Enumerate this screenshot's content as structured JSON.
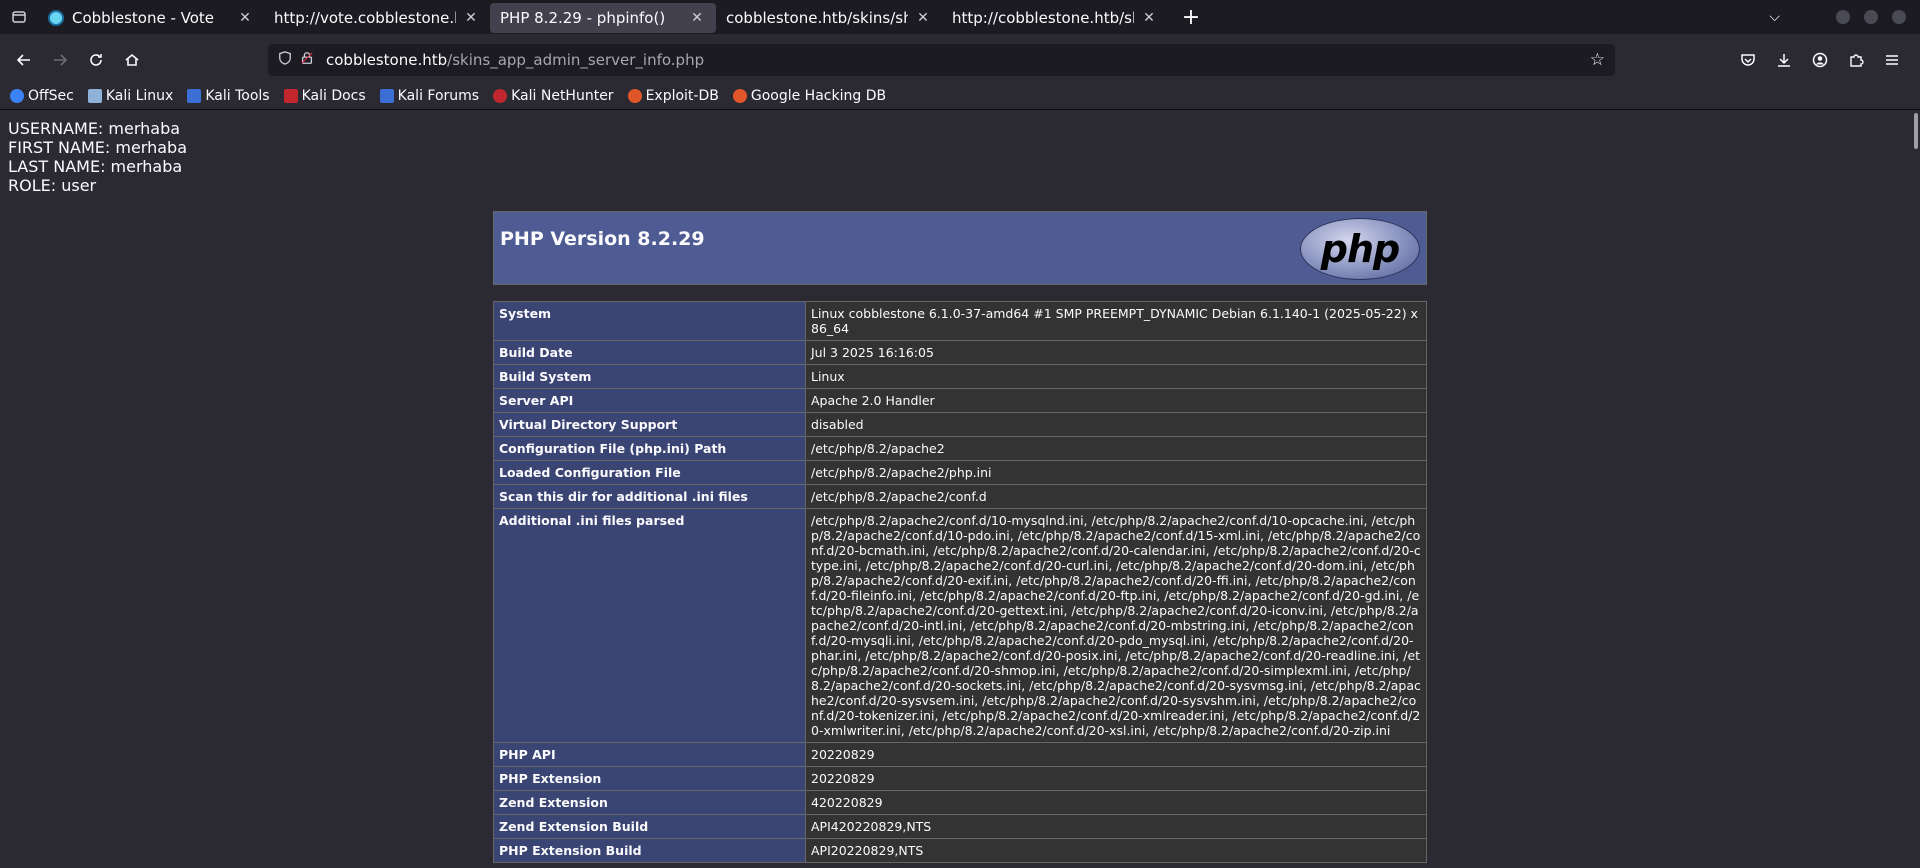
{
  "tabs": [
    {
      "title": "Cobblestone - Vote",
      "dim": "",
      "active": false
    },
    {
      "title": "http://vote.cobblestone.htb/",
      "dim": "l",
      "active": false
    },
    {
      "title": "PHP 8.2.29 - phpinfo()",
      "dim": "",
      "active": true
    },
    {
      "title": "cobblestone.htb/skins/shell.",
      "dim": "p",
      "active": false
    },
    {
      "title": "http://cobblestone.htb/skins/",
      "dim": "",
      "active": false
    }
  ],
  "url": {
    "host": "cobblestone.htb",
    "path": "/skins_app_admin_server_info.php"
  },
  "bookmarks": [
    {
      "label": "OffSec",
      "color": "#3b82f6"
    },
    {
      "label": "Kali Linux",
      "color": "#8fb2d8"
    },
    {
      "label": "Kali Tools",
      "color": "#3b6fd6"
    },
    {
      "label": "Kali Docs",
      "color": "#c2272d"
    },
    {
      "label": "Kali Forums",
      "color": "#3b6fd6"
    },
    {
      "label": "Kali NetHunter",
      "color": "#c2272d"
    },
    {
      "label": "Exploit-DB",
      "color": "#e0562a"
    },
    {
      "label": "Google Hacking DB",
      "color": "#e0562a"
    }
  ],
  "user": {
    "username": "USERNAME: merhaba",
    "first_name": "FIRST NAME: merhaba",
    "last_name": "LAST NAME: merhaba",
    "role": "ROLE: user"
  },
  "php": {
    "version_title": "PHP Version 8.2.29",
    "logo_text": "php",
    "rows": [
      {
        "k": "System",
        "v": "Linux cobblestone 6.1.0-37-amd64 #1 SMP PREEMPT_DYNAMIC Debian 6.1.140-1 (2025-05-22) x86_64"
      },
      {
        "k": "Build Date",
        "v": "Jul 3 2025 16:16:05"
      },
      {
        "k": "Build System",
        "v": "Linux"
      },
      {
        "k": "Server API",
        "v": "Apache 2.0 Handler"
      },
      {
        "k": "Virtual Directory Support",
        "v": "disabled"
      },
      {
        "k": "Configuration File (php.ini) Path",
        "v": "/etc/php/8.2/apache2"
      },
      {
        "k": "Loaded Configuration File",
        "v": "/etc/php/8.2/apache2/php.ini"
      },
      {
        "k": "Scan this dir for additional .ini files",
        "v": "/etc/php/8.2/apache2/conf.d"
      },
      {
        "k": "Additional .ini files parsed",
        "v": "/etc/php/8.2/apache2/conf.d/10-mysqlnd.ini, /etc/php/8.2/apache2/conf.d/10-opcache.ini, /etc/php/8.2/apache2/conf.d/10-pdo.ini, /etc/php/8.2/apache2/conf.d/15-xml.ini, /etc/php/8.2/apache2/conf.d/20-bcmath.ini, /etc/php/8.2/apache2/conf.d/20-calendar.ini, /etc/php/8.2/apache2/conf.d/20-ctype.ini, /etc/php/8.2/apache2/conf.d/20-curl.ini, /etc/php/8.2/apache2/conf.d/20-dom.ini, /etc/php/8.2/apache2/conf.d/20-exif.ini, /etc/php/8.2/apache2/conf.d/20-ffi.ini, /etc/php/8.2/apache2/conf.d/20-fileinfo.ini, /etc/php/8.2/apache2/conf.d/20-ftp.ini, /etc/php/8.2/apache2/conf.d/20-gd.ini, /etc/php/8.2/apache2/conf.d/20-gettext.ini, /etc/php/8.2/apache2/conf.d/20-iconv.ini, /etc/php/8.2/apache2/conf.d/20-intl.ini, /etc/php/8.2/apache2/conf.d/20-mbstring.ini, /etc/php/8.2/apache2/conf.d/20-mysqli.ini, /etc/php/8.2/apache2/conf.d/20-pdo_mysql.ini, /etc/php/8.2/apache2/conf.d/20-phar.ini, /etc/php/8.2/apache2/conf.d/20-posix.ini, /etc/php/8.2/apache2/conf.d/20-readline.ini, /etc/php/8.2/apache2/conf.d/20-shmop.ini, /etc/php/8.2/apache2/conf.d/20-simplexml.ini, /etc/php/8.2/apache2/conf.d/20-sockets.ini, /etc/php/8.2/apache2/conf.d/20-sysvmsg.ini, /etc/php/8.2/apache2/conf.d/20-sysvsem.ini, /etc/php/8.2/apache2/conf.d/20-sysvshm.ini, /etc/php/8.2/apache2/conf.d/20-tokenizer.ini, /etc/php/8.2/apache2/conf.d/20-xmlreader.ini, /etc/php/8.2/apache2/conf.d/20-xmlwriter.ini, /etc/php/8.2/apache2/conf.d/20-xsl.ini, /etc/php/8.2/apache2/conf.d/20-zip.ini"
      },
      {
        "k": "PHP API",
        "v": "20220829"
      },
      {
        "k": "PHP Extension",
        "v": "20220829"
      },
      {
        "k": "Zend Extension",
        "v": "420220829"
      },
      {
        "k": "Zend Extension Build",
        "v": "API420220829,NTS"
      },
      {
        "k": "PHP Extension Build",
        "v": "API20220829,NTS"
      }
    ]
  }
}
